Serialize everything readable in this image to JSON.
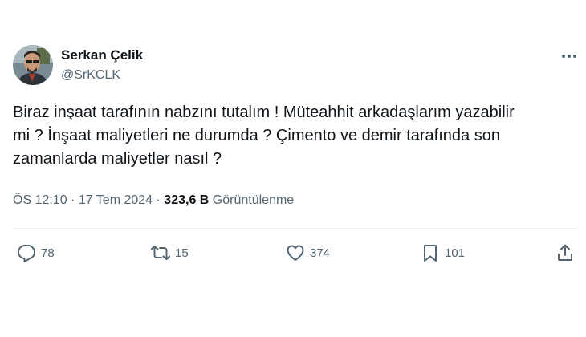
{
  "author": {
    "name": "Serkan Çelik",
    "handle": "@SrKCLK"
  },
  "tweet": {
    "text": "Biraz inşaat tarafının nabzını tutalım ! Müteahhit arkadaşlarım yazabilir\nmi ? İnşaat maliyetleri ne durumda ? Çimento ve demir tarafında son\nzamanlarda maliyetler nasıl ?",
    "time": "ÖS 12:10",
    "date": "17 Tem 2024",
    "views_count": "323,6 B",
    "views_label": "Görüntülenme"
  },
  "actions": {
    "replies": "78",
    "reposts": "15",
    "likes": "374",
    "bookmarks": "101"
  },
  "icons": [
    "avatar",
    "more-icon",
    "reply-icon",
    "repost-icon",
    "like-icon",
    "bookmark-icon",
    "share-icon"
  ],
  "colors": {
    "text": "#0f1419",
    "secondary": "#536471",
    "divider": "#eff3f4"
  }
}
